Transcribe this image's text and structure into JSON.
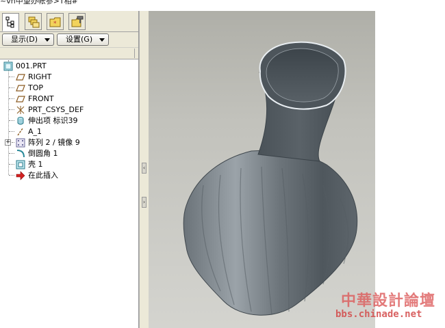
{
  "window": {
    "title_fragment": "~vn中望办帐参>T相#"
  },
  "tabs": [
    {
      "icon": "model-tree-icon"
    },
    {
      "icon": "folder-browser-icon"
    },
    {
      "icon": "favorites-icon"
    },
    {
      "icon": "connections-icon"
    }
  ],
  "toolbar": {
    "show_label": "显示(D)",
    "settings_label": "设置(G)"
  },
  "tree": {
    "root": "001.PRT",
    "items": [
      {
        "label": "RIGHT",
        "icon": "datum-plane-icon"
      },
      {
        "label": "TOP",
        "icon": "datum-plane-icon"
      },
      {
        "label": "FRONT",
        "icon": "datum-plane-icon"
      },
      {
        "label": "PRT_CSYS_DEF",
        "icon": "coordinate-system-icon"
      },
      {
        "label": "伸出项 标识39",
        "icon": "protrusion-icon"
      },
      {
        "label": "A_1",
        "icon": "datum-axis-icon"
      },
      {
        "label": "阵列 2 / 镜像 9",
        "icon": "pattern-icon"
      },
      {
        "label": "倒圆角 1",
        "icon": "round-icon"
      },
      {
        "label": "壳 1",
        "icon": "shell-icon"
      },
      {
        "label": "在此插入",
        "icon": "insert-here-arrow-icon"
      }
    ]
  },
  "watermark": {
    "text": "中華設計論壇",
    "url": "bbs.chinade.net"
  }
}
